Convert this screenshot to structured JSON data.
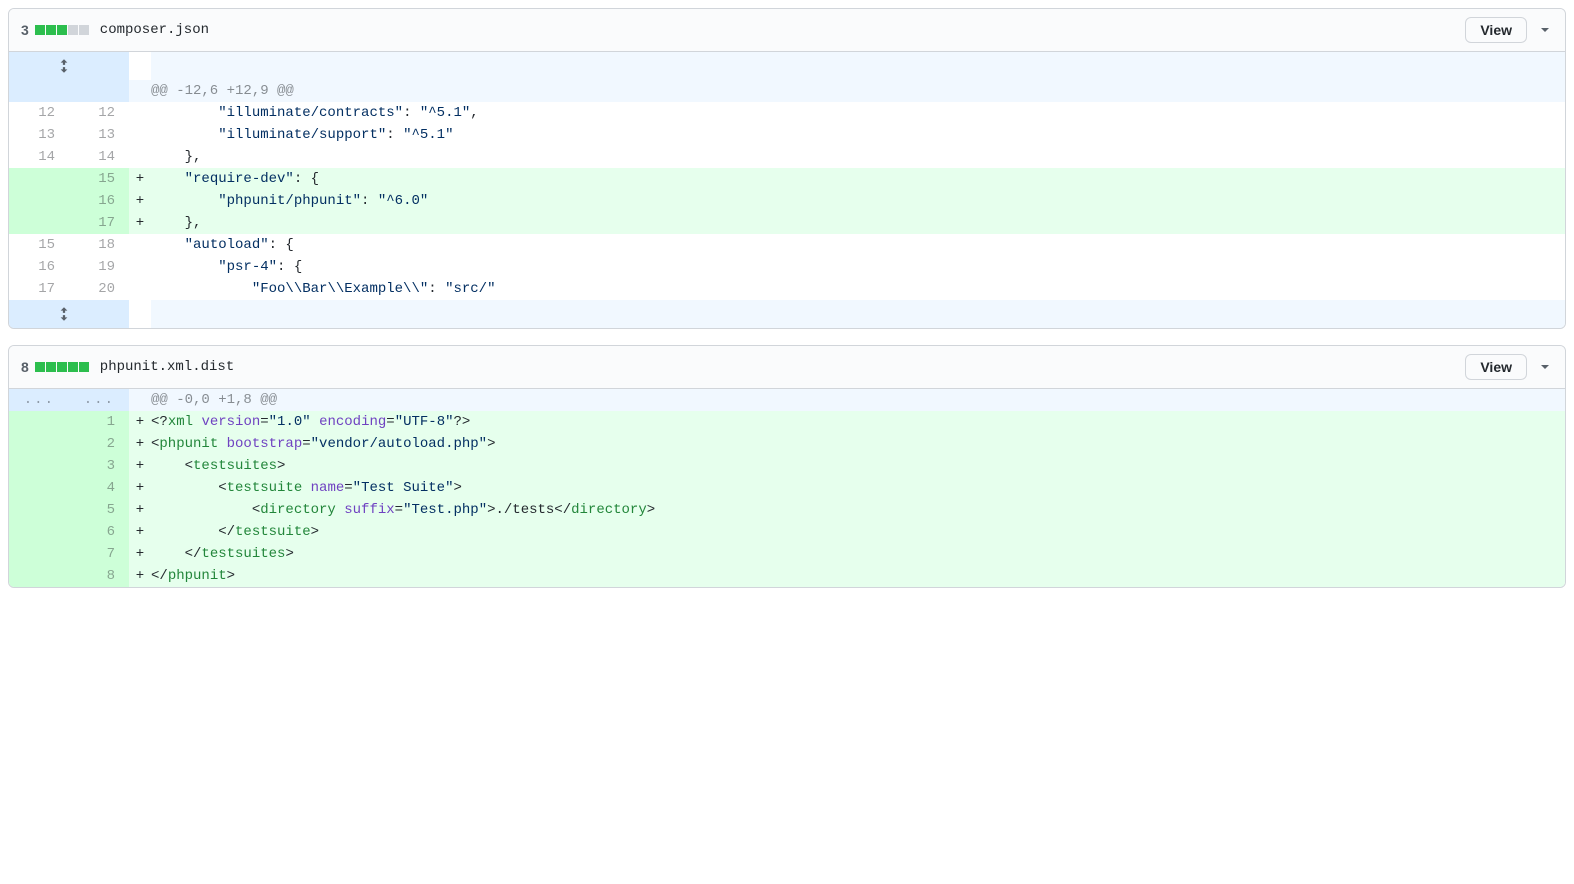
{
  "view_label": "View",
  "files": [
    {
      "changes": "3",
      "bars": [
        true,
        true,
        true,
        false,
        false
      ],
      "filename": "composer.json",
      "rows": [
        {
          "t": "expand",
          "l": "",
          "r": "",
          "html": ""
        },
        {
          "t": "hunk",
          "l": "",
          "r": "",
          "html": "@@ -12,6 +12,9 @@"
        },
        {
          "t": "ctx",
          "l": "12",
          "r": "12",
          "html": "        <span class='s-key'>\"illuminate/contracts\"</span>: <span class='s-str'>\"^5.1\"</span>,"
        },
        {
          "t": "ctx",
          "l": "13",
          "r": "13",
          "html": "        <span class='s-key'>\"illuminate/support\"</span>: <span class='s-str'>\"^5.1\"</span>"
        },
        {
          "t": "ctx",
          "l": "14",
          "r": "14",
          "html": "    },"
        },
        {
          "t": "add",
          "l": "",
          "r": "15",
          "html": "    <span class='s-key'>\"require-dev\"</span>: {"
        },
        {
          "t": "add",
          "l": "",
          "r": "16",
          "html": "        <span class='s-key'>\"phpunit/phpunit\"</span>: <span class='s-str'>\"^6.0\"</span>"
        },
        {
          "t": "add",
          "l": "",
          "r": "17",
          "html": "    },"
        },
        {
          "t": "ctx",
          "l": "15",
          "r": "18",
          "html": "    <span class='s-key'>\"autoload\"</span>: {"
        },
        {
          "t": "ctx",
          "l": "16",
          "r": "19",
          "html": "        <span class='s-key'>\"psr-4\"</span>: {"
        },
        {
          "t": "ctx",
          "l": "17",
          "r": "20",
          "html": "            <span class='s-key'>\"Foo\\\\Bar\\\\Example\\\\\"</span>: <span class='s-str'>\"src/\"</span>"
        },
        {
          "t": "expand",
          "l": "",
          "r": "",
          "html": ""
        }
      ]
    },
    {
      "changes": "8",
      "bars": [
        true,
        true,
        true,
        true,
        true
      ],
      "filename": "phpunit.xml.dist",
      "rows": [
        {
          "t": "hunk",
          "l": "...",
          "r": "...",
          "html": "@@ -0,0 +1,8 @@",
          "dots": true
        },
        {
          "t": "add",
          "l": "",
          "r": "1",
          "html": "&lt;?<span class='s-tag'>xml</span> <span class='s-attr'>version</span>=<span class='s-val'>\"1.0\"</span> <span class='s-attr'>encoding</span>=<span class='s-val'>\"UTF-8\"</span>?&gt;"
        },
        {
          "t": "add",
          "l": "",
          "r": "2",
          "html": "&lt;<span class='s-tag'>phpunit</span> <span class='s-attr'>bootstrap</span>=<span class='s-val'>\"vendor/autoload.php\"</span>&gt;"
        },
        {
          "t": "add",
          "l": "",
          "r": "3",
          "html": "    &lt;<span class='s-tag'>testsuites</span>&gt;"
        },
        {
          "t": "add",
          "l": "",
          "r": "4",
          "html": "        &lt;<span class='s-tag'>testsuite</span> <span class='s-attr'>name</span>=<span class='s-val'>\"Test Suite\"</span>&gt;"
        },
        {
          "t": "add",
          "l": "",
          "r": "5",
          "html": "            &lt;<span class='s-tag'>directory</span> <span class='s-attr'>suffix</span>=<span class='s-val'>\"Test.php\"</span>&gt;./tests&lt;/<span class='s-tag'>directory</span>&gt;"
        },
        {
          "t": "add",
          "l": "",
          "r": "6",
          "html": "        &lt;/<span class='s-tag'>testsuite</span>&gt;"
        },
        {
          "t": "add",
          "l": "",
          "r": "7",
          "html": "    &lt;/<span class='s-tag'>testsuites</span>&gt;"
        },
        {
          "t": "add",
          "l": "",
          "r": "8",
          "html": "&lt;/<span class='s-tag'>phpunit</span>&gt;"
        }
      ]
    }
  ]
}
